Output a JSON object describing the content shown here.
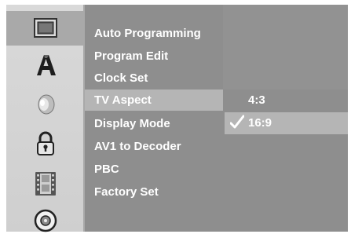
{
  "menu": {
    "items": [
      {
        "label": "Auto Programming"
      },
      {
        "label": "Program Edit"
      },
      {
        "label": "Clock Set"
      },
      {
        "label": "TV Aspect"
      },
      {
        "label": "Display Mode"
      },
      {
        "label": "AV1 to Decoder"
      },
      {
        "label": "PBC"
      },
      {
        "label": "Factory Set"
      }
    ],
    "selected": "TV Aspect"
  },
  "options": {
    "items": [
      {
        "label": "4:3"
      },
      {
        "label": "16:9"
      }
    ],
    "selected": "16:9"
  },
  "icons": [
    "screen-icon",
    "language-icon",
    "audio-icon",
    "lock-icon",
    "film-icon",
    "disc-icon"
  ],
  "colors": {
    "panel": "#8e8e8e",
    "icon_column": "#d6d6d6",
    "highlight": "#b5b5b5",
    "text": "#ffffff"
  }
}
